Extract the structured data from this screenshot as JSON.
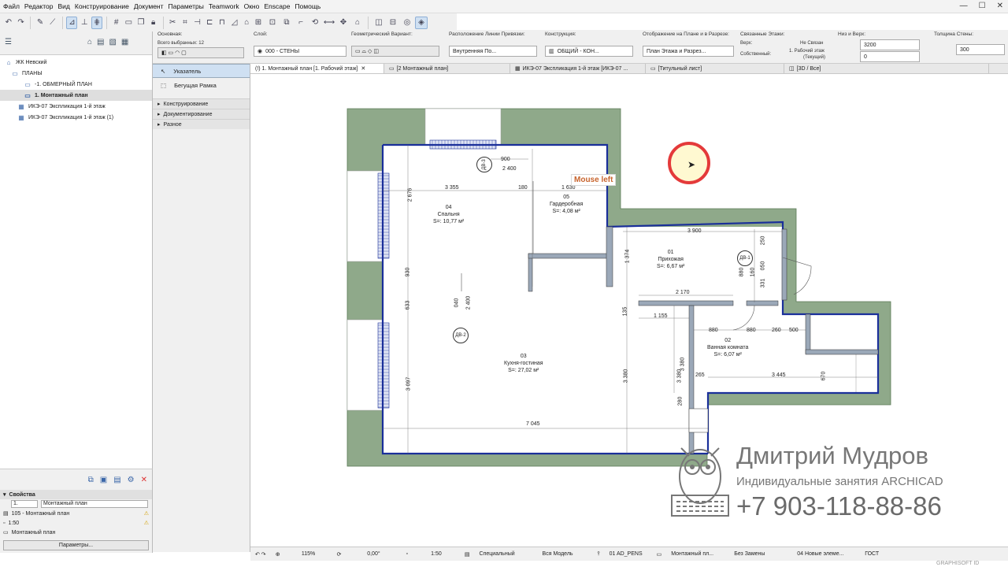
{
  "menu": [
    "Файл",
    "Редактор",
    "Вид",
    "Конструирование",
    "Документ",
    "Параметры",
    "Teamwork",
    "Окно",
    "Enscape",
    "Помощь"
  ],
  "info_box": {
    "osnovnaya_label": "Основная:",
    "selected": "Всего выбранных: 12",
    "layer_label": "Слой:",
    "layer_value": "000 - СТЕНЫ",
    "geom_label": "Геометрический Вариант:",
    "refline_label": "Расположение Линии Привязки:",
    "refline_value": "Внутренняя По...",
    "construct_label": "Конструкция:",
    "construct_value": "ОБЩИЙ - КОН...",
    "display_label": "Отображение на Плане и в Разрезе:",
    "display_value": "План Этажа и Разрез...",
    "linked_label": "Связанные Этажи:",
    "top_label": "Верх:",
    "top_value": "Не Связан",
    "own_label": "Собственный:",
    "own_value_1": "1. Рабочий этаж",
    "own_value_2": "(Текущий)",
    "height_label": "Низ и Верх:",
    "height_top": "3200",
    "height_bottom": "0",
    "thick_label": "Толщина Стены:",
    "thick_value": "300"
  },
  "tabs": [
    {
      "label": "(!) 1. Монтажный план [1. Рабочий этаж]",
      "active": true
    },
    {
      "label": "[2 Монтажный план]",
      "active": false
    },
    {
      "label": "ИКЭ-07 Экспликация 1-й этаж [ИКЭ-07 ...",
      "active": false
    },
    {
      "label": "[Титульный лист]",
      "active": false
    },
    {
      "label": "[3D / Все]",
      "active": false
    }
  ],
  "tree": [
    {
      "label": "ЖК Невский",
      "indent": 0,
      "icon": "house-icon"
    },
    {
      "label": "ПЛАНЫ",
      "indent": 1,
      "icon": "folder-icon"
    },
    {
      "label": "-1. ОБМЕРНЫЙ ПЛАН",
      "indent": 2,
      "icon": "plan-icon"
    },
    {
      "label": "1. Монтажный план",
      "indent": 2,
      "icon": "plan-icon",
      "selected": true
    },
    {
      "label": "ИКЭ-07 Экспликация 1-й этаж",
      "indent": 1,
      "icon": "table-icon"
    },
    {
      "label": "ИКЭ-07 Экспликация 1-й этаж (1)",
      "indent": 1,
      "icon": "table-icon"
    }
  ],
  "toolbox": {
    "pointer": "Указатель",
    "marquee": "Бегущая Рамка",
    "groups": [
      "Конструирование",
      "Документирование",
      "Разное"
    ]
  },
  "properties": {
    "title": "Свойства",
    "id": "1.",
    "name": "Монтажный план",
    "row1": "105 - Монтажный план",
    "row2": "1:50",
    "row3": "Монтажный план",
    "button": "Параметры..."
  },
  "status": {
    "zoom": "115%",
    "angle": "0,00°",
    "scale": "1:50",
    "layer_combo": "Специальный",
    "model": "Вся Модель",
    "pens": "01 AD_PENS",
    "view": "Монтажный пл...",
    "override": "Без Замены",
    "reno": "04 Новые элеме...",
    "standard": "ГОСТ"
  },
  "plan": {
    "dims": [
      "900",
      "2 400",
      "3 355",
      "180",
      "1 630",
      "3 900",
      "2 170",
      "1 155",
      "880",
      "880",
      "260",
      "500",
      "3 445",
      "7 045",
      "265",
      "2 676",
      "930",
      "633",
      "3 097",
      "2 400",
      "040",
      "3 380",
      "135",
      "3 380",
      "250",
      "880",
      "160",
      "331",
      "050",
      "670",
      "1 374",
      "3 380",
      "280"
    ],
    "rooms": [
      {
        "num": "04",
        "name": "Спальня",
        "area": "S=: 10,77 м²"
      },
      {
        "num": "05",
        "name": "Гардеробная",
        "area": "S=: 4,08 м²"
      },
      {
        "num": "01",
        "name": "Прихожая",
        "area": "S=: 6,67 м²"
      },
      {
        "num": "02",
        "name": "Ванная комната",
        "area": "S=: 6,07 м²"
      },
      {
        "num": "03",
        "name": "Кухня-гостиная",
        "area": "S=: 27,02 м²"
      }
    ],
    "doors": [
      "ДВ-3",
      "ДВ-1",
      "ДВ-2"
    ],
    "colors": {
      "slab": "#8fa98a",
      "wall": "#1a2f9a",
      "grid": "#9aa"
    }
  },
  "tooltip": "Mouse left",
  "watermark": {
    "name": "Дмитрий Мудров",
    "subtitle": "Индивидуальные занятия ARCHICAD",
    "phone": "+7 903-118-88-86"
  },
  "brand": "GRAPHISOFT ID"
}
